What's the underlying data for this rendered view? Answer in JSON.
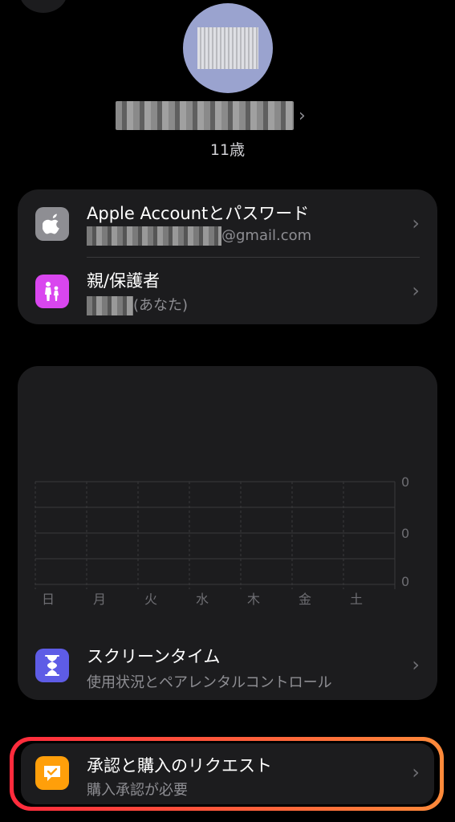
{
  "profile": {
    "age": "11歳",
    "name_blurred": true,
    "chevron": "chevron-right-icon"
  },
  "account_card": {
    "apple_account": {
      "title": "Apple Accountとパスワード",
      "email_suffix": "@gmail.com",
      "icon": "apple-logo-icon",
      "icon_bg": "#8e8e93"
    },
    "guardian": {
      "title": "親/保護者",
      "sub_suffix": "(あなた)",
      "icon": "family-icon",
      "icon_bg": "#d946ef"
    }
  },
  "chart_data": {
    "type": "bar",
    "categories": [
      "日",
      "月",
      "火",
      "水",
      "木",
      "金",
      "土"
    ],
    "values": [
      0,
      0,
      0,
      0,
      0,
      0,
      0
    ],
    "y_tick_labels": [
      "0",
      "0",
      "0"
    ],
    "grid": true
  },
  "screen_time": {
    "title": "スクリーンタイム",
    "subtitle": "使用状況とペアレンタルコントロール",
    "icon": "hourglass-icon",
    "icon_bg": "#5e5ce6"
  },
  "requests": {
    "title": "承認と購入のリクエスト",
    "subtitle": "購入承認が必要",
    "icon": "checkmark-bubble-icon",
    "icon_bg": "#ff9f0a",
    "highlight_colors": [
      "#ff2a3c",
      "#ff8a3a"
    ]
  }
}
